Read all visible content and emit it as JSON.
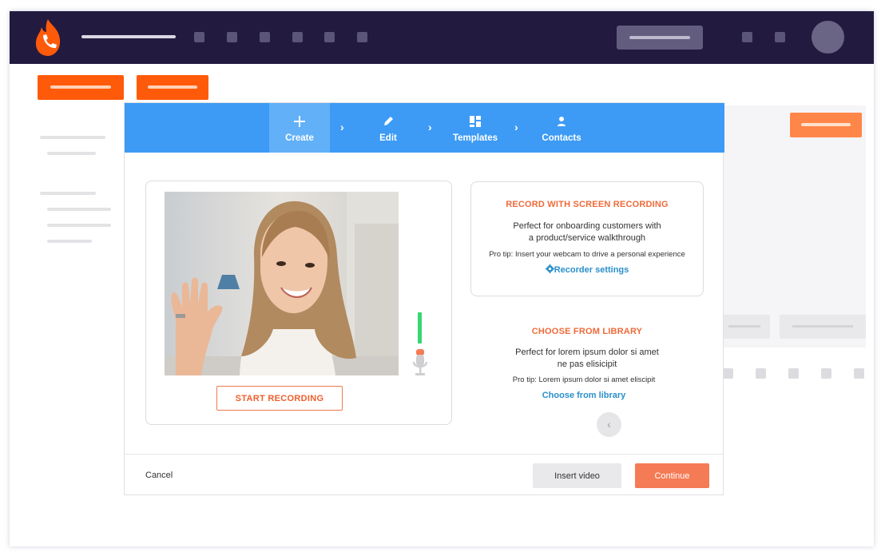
{
  "colors": {
    "nav_bg": "#231b3f",
    "brand_orange": "#ff5a0a",
    "stepper_blue": "#3d9bf5",
    "accent_red": "#ee6a3a",
    "link_blue": "#2a8fcb"
  },
  "icons": {
    "logo": "flame-phone-icon",
    "create": "plus-icon",
    "edit": "pencil-icon",
    "templates": "grid-icon",
    "contacts": "person-icon",
    "settings": "gear-icon",
    "mic": "microphone-icon",
    "back": "chevron-left-icon"
  },
  "stepper": {
    "steps": [
      {
        "label": "Create"
      },
      {
        "label": "Edit"
      },
      {
        "label": "Templates"
      },
      {
        "label": "Contacts"
      }
    ],
    "separator": "›"
  },
  "recorder": {
    "start_label": "START RECORDING",
    "level": 0.55
  },
  "screen_card": {
    "title": "RECORD WITH SCREEN RECORDING",
    "desc_line1": "Perfect for onboarding customers with",
    "desc_line2": "a product/service walkthrough",
    "tip": "Pro tip: Insert your webcam to drive a personal experience",
    "link": "Recorder settings"
  },
  "library": {
    "title": "CHOOSE FROM LIBRARY",
    "desc_line1": "Perfect for lorem ipsum dolor si amet",
    "desc_line2": "ne pas elisicipit",
    "tip": "Pro tip: Lorem ipsum dolor si amet eliscipit",
    "link": "Choose from library",
    "back_glyph": "‹"
  },
  "footer": {
    "cancel": "Cancel",
    "insert": "Insert video",
    "continue": "Continue"
  }
}
